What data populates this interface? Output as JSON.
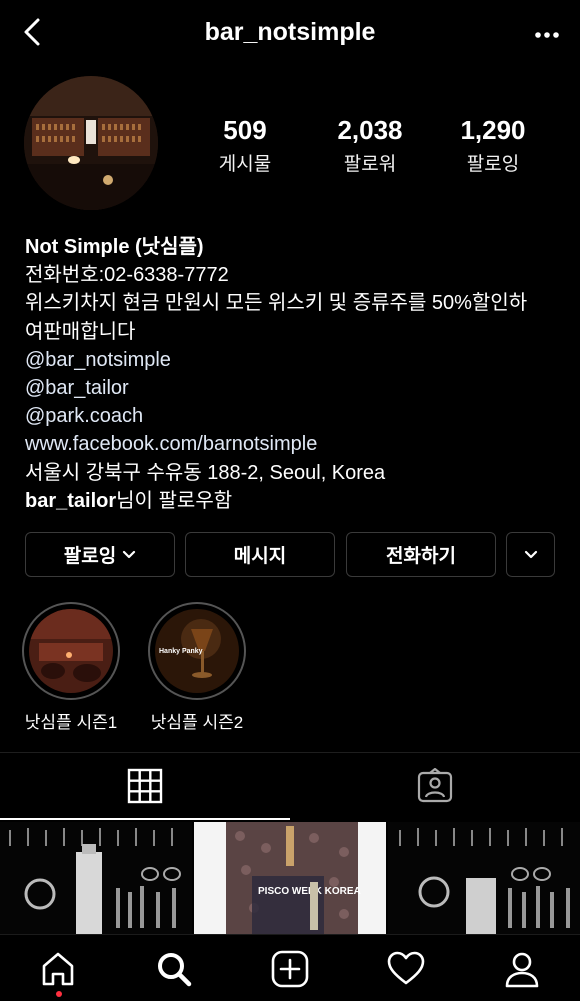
{
  "header": {
    "username": "bar_notsimple"
  },
  "stats": {
    "posts": {
      "value": "509",
      "label": "게시물"
    },
    "followers": {
      "value": "2,038",
      "label": "팔로워"
    },
    "following": {
      "value": "1,290",
      "label": "팔로잉"
    }
  },
  "bio": {
    "name": "Not Simple (낫심플)",
    "phone": "전화번호:02-6338-7772",
    "description_line1": "위스키차지 현금 만원시 모든 위스키 및 증류주를 50%할인하",
    "description_line2": "여판매합니다",
    "mention1": "@bar_notsimple",
    "mention2": "@bar_tailor",
    "mention3": "@park.coach",
    "website": "www.facebook.com/barnotsimple",
    "address": "서울시 강북구 수유동 188-2, Seoul, Korea",
    "followed_by_user": "bar_tailor",
    "followed_by_suffix": "님이 팔로우함"
  },
  "actions": {
    "following_label": "팔로잉",
    "message_label": "메시지",
    "call_label": "전화하기"
  },
  "highlights": [
    {
      "label": "낫심플 시즌1"
    },
    {
      "label": "낫심플 시즌2"
    }
  ],
  "grid_posts": [
    {
      "overlay_text": ""
    },
    {
      "overlay_text": "PISCO WEEK KOREA"
    },
    {
      "overlay_text": ""
    }
  ],
  "highlight2_overlay": "Hanky Panky",
  "colors": {
    "background": "#000000",
    "text": "#ffffff",
    "button_border": "#3a3a3a",
    "notification_dot": "#ff3040"
  }
}
